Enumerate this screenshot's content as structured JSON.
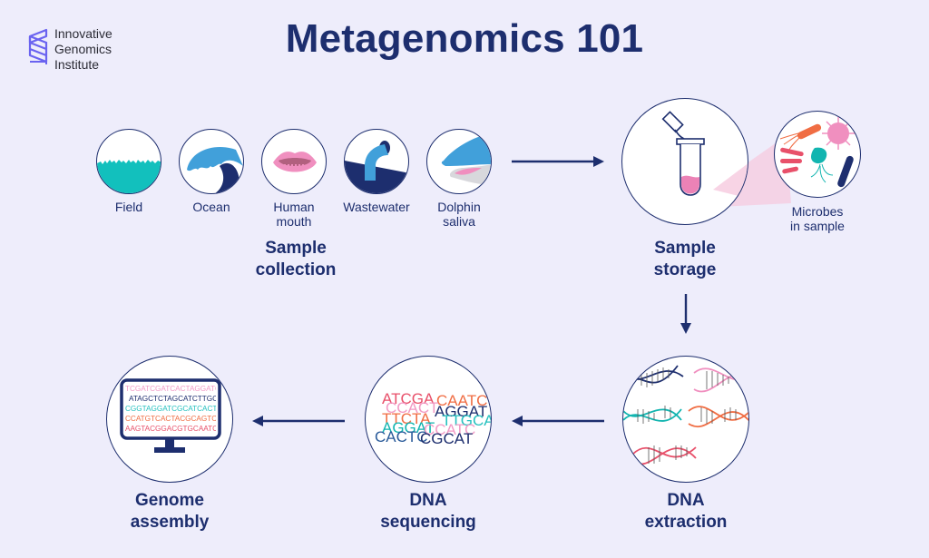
{
  "header": {
    "logo_lines": [
      "Innovative",
      "Genomics",
      "Institute"
    ],
    "title": "Metagenomics 101"
  },
  "samples": [
    {
      "label": "Field",
      "icon": "field-icon"
    },
    {
      "label": "Ocean",
      "icon": "ocean-wave-icon"
    },
    {
      "label": "Human\nmouth",
      "label_lines": [
        "Human",
        "mouth"
      ],
      "icon": "mouth-icon"
    },
    {
      "label": "Wastewater",
      "icon": "wastewater-pipe-icon"
    },
    {
      "label_lines": [
        "Dolphin",
        "saliva"
      ],
      "icon": "dolphin-icon"
    }
  ],
  "stages": {
    "collection": [
      "Sample",
      "collection"
    ],
    "storage": [
      "Sample",
      "storage"
    ],
    "extraction": [
      "DNA",
      "extraction"
    ],
    "sequencing": [
      "DNA",
      "sequencing"
    ],
    "assembly": [
      "Genome",
      "assembly"
    ]
  },
  "microbes_label": [
    "Microbes",
    "in sample"
  ],
  "sequencing_reads": [
    {
      "text": "ATCGA",
      "color": "#e8506a"
    },
    {
      "text": "CAATC",
      "color": "#f06d43"
    },
    {
      "text": "CCACT",
      "color": "#f29ac5"
    },
    {
      "text": "AGGAT",
      "color": "#1d2e6e"
    },
    {
      "text": "TTCTA",
      "color": "#f06d43"
    },
    {
      "text": "TTGCA",
      "color": "#25c1bf"
    },
    {
      "text": "AGGAT",
      "color": "#12b5b0"
    },
    {
      "text": "CCATC",
      "color": "#f29ac5"
    },
    {
      "text": "CACTC",
      "color": "#2a5b9a"
    },
    {
      "text": "CGCAT",
      "color": "#1d2e6e"
    }
  ],
  "assembly_lines": [
    {
      "text": "TCGATCGATCACTAGGATCGA",
      "color": "#f29ac5"
    },
    {
      "text": "ATAGCTCTAGCATCTTGCATT",
      "color": "#1d2e6e"
    },
    {
      "text": "CGGTAGGATCGCATCACTCCG",
      "color": "#25c1bf"
    },
    {
      "text": "CCATGTCACTACGCAGTCATA",
      "color": "#f06d43"
    },
    {
      "text": "AAGTACGGACGTGCAATCGCA",
      "color": "#e8506a"
    }
  ],
  "colors": {
    "background": "#eeedfb",
    "navy": "#1d2e6e",
    "teal": "#12c0bd",
    "blue": "#41a0da",
    "pink": "#f08fbf",
    "orange": "#f06d43",
    "red": "#e8506a",
    "logo": "#6a63f0"
  }
}
